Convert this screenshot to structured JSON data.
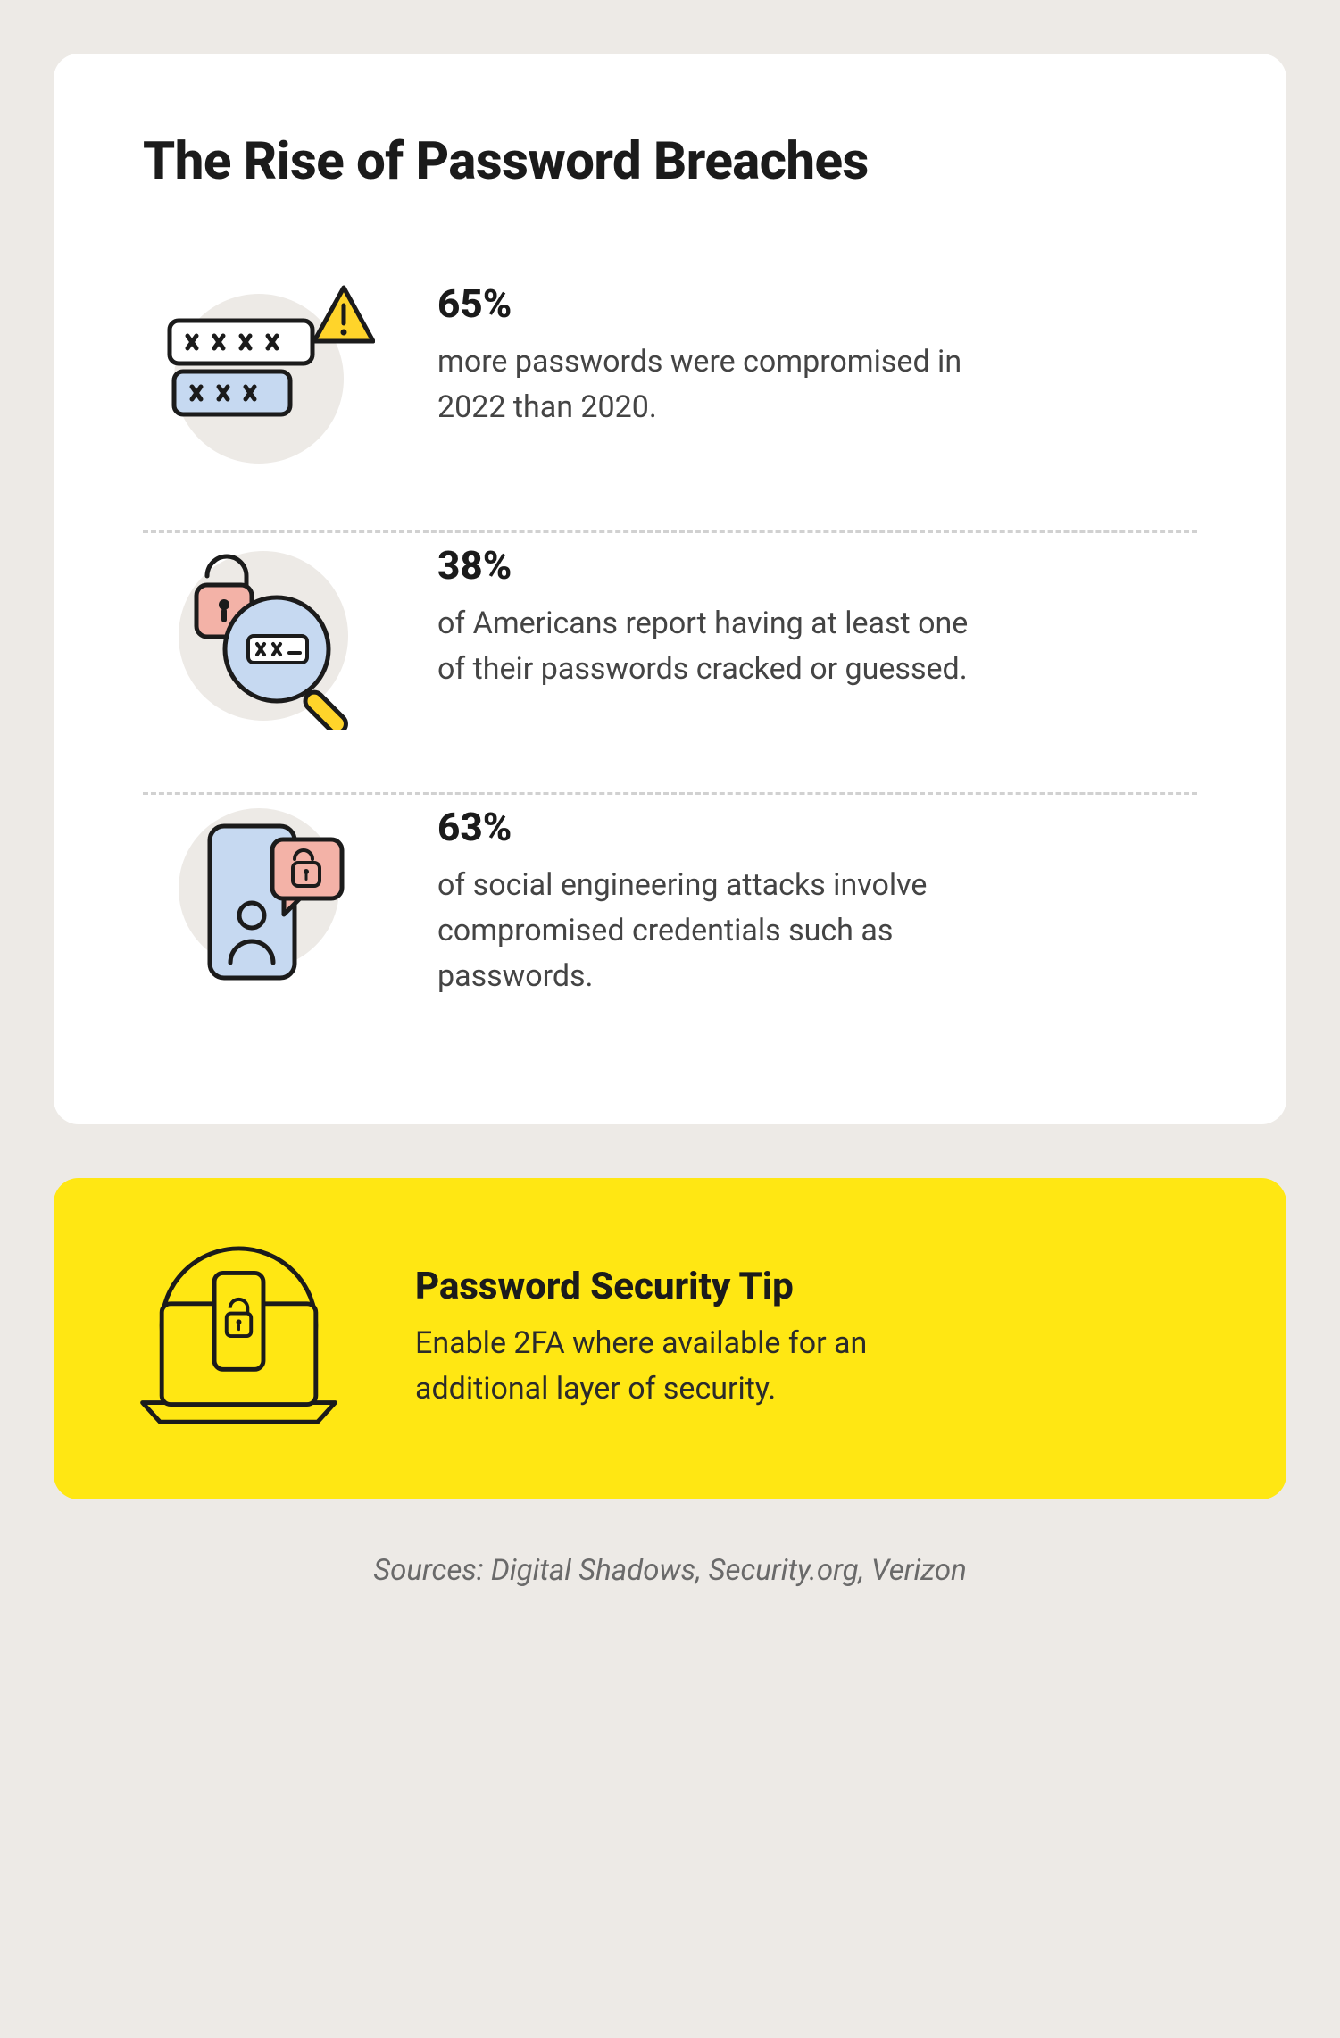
{
  "title": "The Rise of Password Breaches",
  "stats": [
    {
      "value": "65%",
      "desc": "more passwords were compromised in 2022 than 2020."
    },
    {
      "value": "38%",
      "desc": "of Americans report having at least one of their passwords cracked or guessed."
    },
    {
      "value": "63%",
      "desc": "of social engineering attacks involve compromised credentials such as passwords."
    }
  ],
  "tip": {
    "title": "Password Security Tip",
    "desc": "Enable 2FA where available for an additional layer of security."
  },
  "sources": "Sources: Digital Shadows, Security.org, Verizon",
  "colors": {
    "yellow": "#ffe713",
    "pink": "#f3b2a7",
    "blue": "#c6d9f1",
    "warn": "#ffd42a",
    "bgCircle": "#edeae6",
    "stroke": "#1b1b1b"
  }
}
